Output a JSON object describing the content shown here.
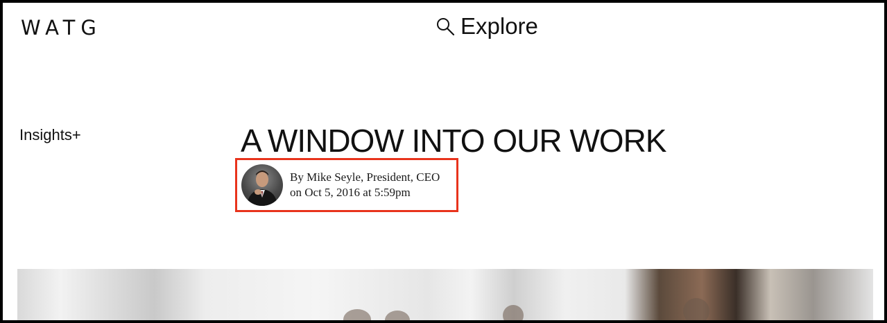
{
  "header": {
    "logo": "WATG",
    "explore_label": "Explore"
  },
  "sidebar": {
    "section_link": "Insights+"
  },
  "article": {
    "title": "A WINDOW INTO OUR WORK",
    "byline": "By Mike Seyle, President, CEO",
    "date": "on Oct 5, 2016 at 5:59pm"
  },
  "colors": {
    "highlight_border": "#e8331c",
    "frame": "#000000"
  },
  "icons": {
    "explore": "search-icon"
  }
}
